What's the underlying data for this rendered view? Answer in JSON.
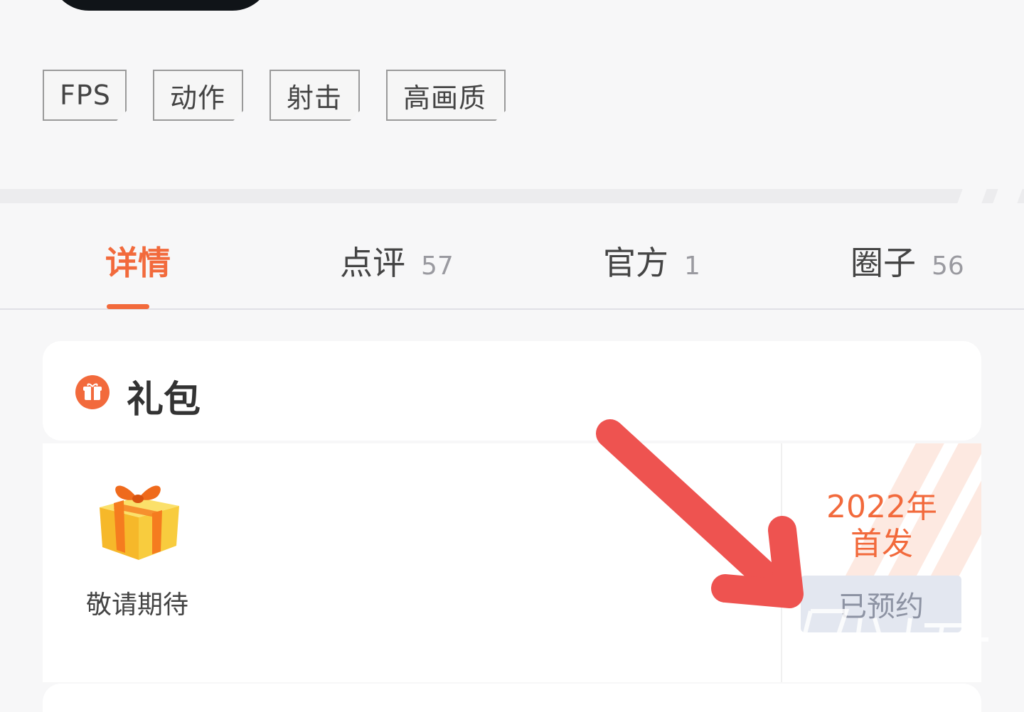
{
  "tags": [
    "FPS",
    "动作",
    "射击",
    "高画质"
  ],
  "tabs": [
    {
      "label": "详情",
      "count": ""
    },
    {
      "label": "点评",
      "count": "57"
    },
    {
      "label": "官方",
      "count": "1"
    },
    {
      "label": "圈子",
      "count": "56"
    }
  ],
  "gift_section": {
    "title": "礼包",
    "item_label": "敬请期待",
    "release_line1": "2022年",
    "release_line2": "首发",
    "reserve_button": "已预约"
  },
  "colors": {
    "accent": "#f26a3c",
    "arrow": "#ee5350"
  }
}
